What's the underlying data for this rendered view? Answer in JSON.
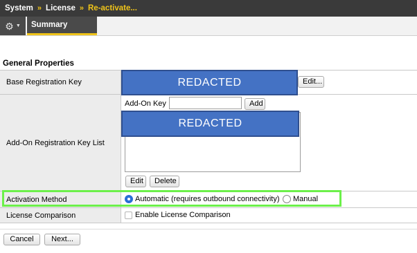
{
  "breadcrumb": {
    "items": [
      "System",
      "License",
      "Re-activate..."
    ],
    "separator": "»"
  },
  "tabs": {
    "settings_icon": "gear-icon",
    "summary_label": "Summary"
  },
  "section": {
    "title": "General Properties"
  },
  "fields": {
    "base_key": {
      "label": "Base Registration Key",
      "value_redacted": "REDACTED",
      "edit_button": "Edit..."
    },
    "addon_list": {
      "label": "Add-On Registration Key List",
      "addon_key_label": "Add-On Key",
      "addon_key_value": "",
      "add_button": "Add",
      "list_redacted": "REDACTED",
      "edit_button": "Edit",
      "delete_button": "Delete"
    },
    "activation": {
      "label": "Activation Method",
      "option_automatic": "Automatic (requires outbound connectivity)",
      "option_manual": "Manual",
      "selected": "automatic"
    },
    "comparison": {
      "label": "License Comparison",
      "checkbox_label": "Enable License Comparison",
      "checked": false
    }
  },
  "footer": {
    "cancel_button": "Cancel",
    "next_button": "Next..."
  },
  "colors": {
    "accent": "#f0c419",
    "redaction": "#4472c4",
    "highlight": "#6cf04a"
  }
}
